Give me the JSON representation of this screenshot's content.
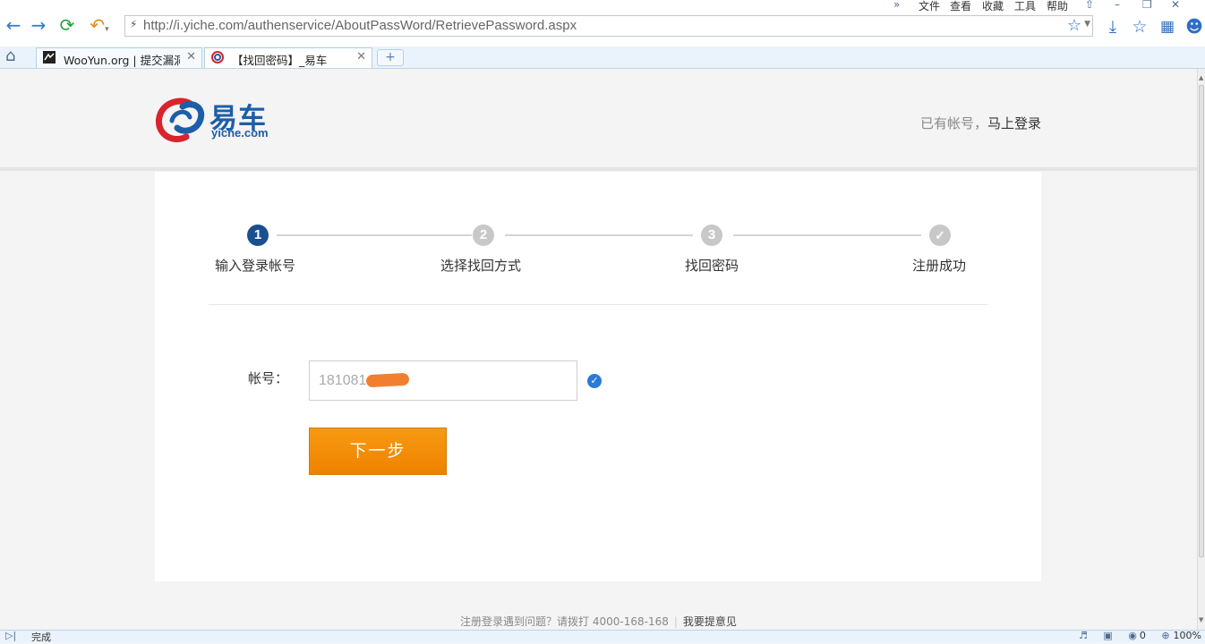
{
  "browser": {
    "url": "http://i.yiche.com/authenservice/AboutPassWord/RetrievePassword.aspx",
    "menu": {
      "more": "»",
      "file": "文件",
      "view": "查看",
      "favorites": "收藏",
      "tools": "工具",
      "help": "帮助"
    },
    "tabs": [
      {
        "label": "WooYun.org | 提交漏洞",
        "favicon": "wooyun-favicon-icon"
      },
      {
        "label": "【找回密码】_易车",
        "favicon": "yiche-favicon-icon"
      }
    ],
    "new_tab": "+",
    "status_text": "完成",
    "status_count": "0",
    "zoom": "100%"
  },
  "header": {
    "logo_text": "易车",
    "logo_domain": "yiche.com",
    "login_prompt": "已有帐号，",
    "login_link": "马上登录"
  },
  "steps": [
    {
      "number": "1",
      "label": "输入登录帐号",
      "state": "active"
    },
    {
      "number": "2",
      "label": "选择找回方式",
      "state": "pending"
    },
    {
      "number": "3",
      "label": "找回密码",
      "state": "pending"
    },
    {
      "number": "✓",
      "label": "注册成功",
      "state": "pending"
    }
  ],
  "form": {
    "account_label": "帐号：",
    "account_value": "181081",
    "next_button": "下一步"
  },
  "footer": {
    "help_text": "注册登录遇到问题？请拨打 4000-168-168",
    "separator": "|",
    "feedback_link": "我要提意见"
  },
  "colors": {
    "brand_blue": "#1d5ea8",
    "active_step": "#1b4f8f",
    "button_orange": "#f48a00",
    "check_blue": "#2a7bd6"
  }
}
